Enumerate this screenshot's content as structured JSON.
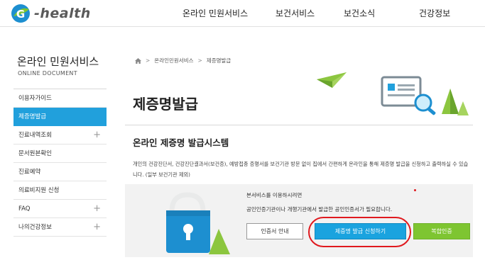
{
  "brand": {
    "logo_text": "-health",
    "logo_initial": "G"
  },
  "nav": {
    "items": [
      {
        "label": "온라인 민원서비스"
      },
      {
        "label": "보건서비스"
      },
      {
        "label": "보건소식"
      },
      {
        "label": "건강정보"
      }
    ]
  },
  "sidebar": {
    "title": "온라인 민원서비스",
    "subtitle": "ONLINE DOCUMENT",
    "items": [
      {
        "label": "이용자가이드",
        "expandable": false,
        "active": false
      },
      {
        "label": "제증명발급",
        "expandable": false,
        "active": true
      },
      {
        "label": "진료내역조회",
        "expandable": true,
        "active": false
      },
      {
        "label": "문서원본확인",
        "expandable": false,
        "active": false
      },
      {
        "label": "진료예약",
        "expandable": false,
        "active": false
      },
      {
        "label": "의료비지원 신청",
        "expandable": false,
        "active": false
      },
      {
        "label": "FAQ",
        "expandable": true,
        "active": false
      },
      {
        "label": "나의건강정보",
        "expandable": true,
        "active": false
      }
    ],
    "expand_symbol": "+"
  },
  "breadcrumb": {
    "home_icon": "home-icon",
    "items": [
      "온라인민원서비스",
      "제증명발급"
    ],
    "separator": ">"
  },
  "main": {
    "page_title": "제증명발급",
    "section_title": "온라인 제증명 발급시스템",
    "description": "개인의 건강진단서, 건강진단결과서(보건증), 예방접종 증명서를 보건기관 방문 없이 집에서 간편하게 온라인을 통해 제증명 발급을 신청하고 출력하실 수 있습니다. (일부 보건기관 제외)",
    "notice_line1": "본서비스를 이용하시려면",
    "notice_line2": "공인인증기관이나 개행기관에서 발급한 공인인증서가 필요합니다.",
    "buttons": {
      "guide": "인증서 안내",
      "apply": "제증명 발급 신청하기",
      "joint": "복합인증"
    }
  },
  "colors": {
    "accent_blue": "#21a0dc",
    "accent_green": "#7ec531",
    "highlight_red": "#e0191e",
    "panel_bg": "#f2f2f2"
  }
}
